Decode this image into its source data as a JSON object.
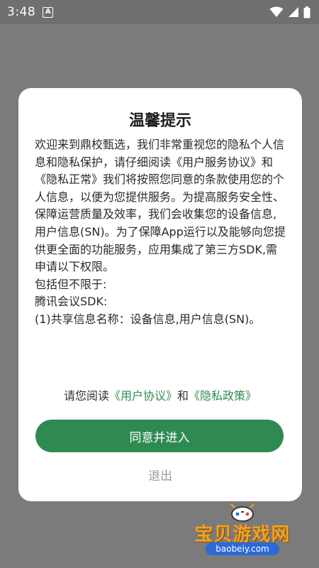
{
  "status_bar": {
    "time": "3:48",
    "notification_icon_letter": "A",
    "icons": [
      "wifi-icon",
      "signal-icon",
      "battery-icon"
    ]
  },
  "dialog": {
    "title": "温馨提示",
    "paragraphs": [
      "欢迎来到鼎校甄选，我们非常重视您的隐私个人信息和隐私保护，请仔细阅读《用户服务协议》和《隐私正常》我们将按照您同意的条款使用您的个人信息，以便为您提供服务。为提高服务安全性、保障运营质量及效率，我们会收集您的设备信息,用户信息(SN)。为了保障App运行以及能够向您提供更全面的功能服务，应用集成了第三方SDK,需申请以下权限。",
      "包括但不限于:",
      "腾讯会议SDK:",
      "(1)共享信息名称：设备信息,用户信息(SN)。"
    ],
    "agree_prefix": "请您阅读",
    "user_agreement_link": "《用户协议》",
    "and_text": "和",
    "privacy_policy_link": "《隐私政策》",
    "agree_button": "同意并进入",
    "exit_button": "退出"
  },
  "watermark": {
    "main": "宝贝游戏网",
    "url": "baobeiy.com"
  },
  "colors": {
    "overlay": "#7b7b7b",
    "status_bar": "#6f6f6f",
    "accent_green": "#2f8a52",
    "exit_gray": "#9a9a9a",
    "watermark_orange": "#f4a21b",
    "watermark_blue": "#2b6ad8"
  }
}
